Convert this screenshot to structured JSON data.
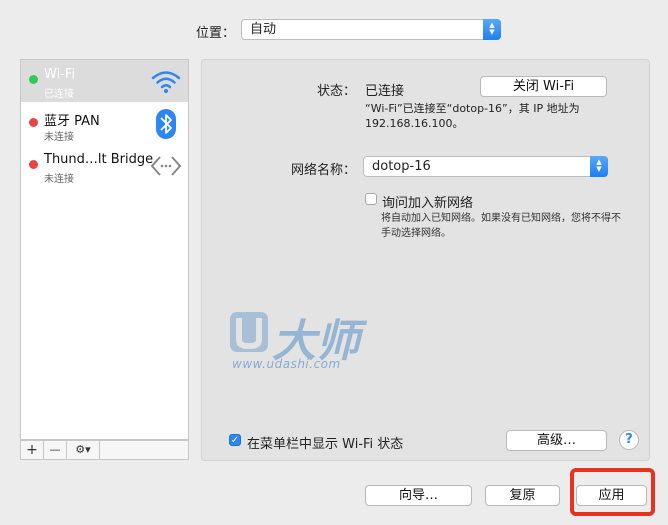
{
  "location": {
    "label": "位置：",
    "value": "自动"
  },
  "services": [
    {
      "name": "Wi-Fi",
      "status": "已连接",
      "dot_color": "#34c759",
      "icon": "wifi-icon",
      "selected": true
    },
    {
      "name": "蓝牙 PAN",
      "status": "未连接",
      "dot_color": "#e84545",
      "icon": "bluetooth-icon",
      "selected": false
    },
    {
      "name": "Thund…lt Bridge",
      "status": "未连接",
      "dot_color": "#e84545",
      "icon": "thunderbolt-bridge-icon",
      "selected": false
    }
  ],
  "sidebar_actions": {
    "add": "+",
    "remove": "—",
    "gear": "⚙︎▾"
  },
  "status": {
    "label": "状态：",
    "value": "已连接",
    "toggle_button": "关闭 Wi-Fi",
    "description": "“Wi-Fi”已连接至“dotop-16”，其 IP 地址为 192.168.16.100。"
  },
  "network_name": {
    "label": "网络名称：",
    "value": "dotop-16"
  },
  "ask_join": {
    "label": "询问加入新网络",
    "checked": false,
    "description": "将自动加入已知网络。如果没有已知网络，您将不得不手动选择网络。"
  },
  "show_in_menubar": {
    "label": "在菜单栏中显示 Wi-Fi 状态",
    "checked": true
  },
  "advanced_button": "高级…",
  "help_button": "?",
  "watermark": {
    "text": "大师",
    "url": "www.udashi.com"
  },
  "footer": {
    "assistant": "向导…",
    "revert": "复原",
    "apply": "应用"
  },
  "colors": {
    "accent": "#2d86f5",
    "highlight": "#e8321f"
  }
}
